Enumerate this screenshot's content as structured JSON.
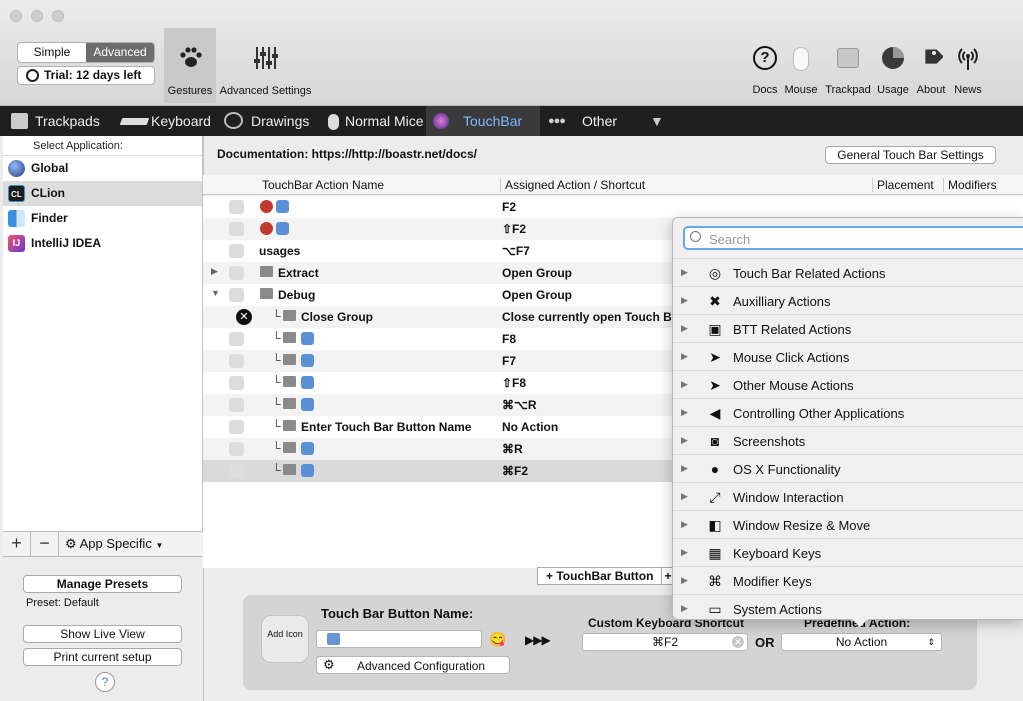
{
  "toolbar": {
    "mode_simple": "Simple",
    "mode_advanced": "Advanced",
    "trial": "Trial: 12 days left",
    "gestures": "Gestures",
    "advanced_settings": "Advanced Settings",
    "docs": "Docs",
    "mouse": "Mouse",
    "trackpad": "Trackpad",
    "usage": "Usage",
    "about": "About",
    "news": "News"
  },
  "tabs": [
    "Trackpads",
    "Keyboard",
    "Drawings",
    "Normal Mice",
    "TouchBar",
    "Other"
  ],
  "sidebar": {
    "header": "Select Application:",
    "apps": [
      {
        "name": "Global",
        "color": "#3b5c9e"
      },
      {
        "name": "CLion",
        "color": "#1c1c1c"
      },
      {
        "name": "Finder",
        "color": "#3a8fe0"
      },
      {
        "name": "IntelliJ IDEA",
        "color": "#b23a8a"
      }
    ],
    "app_specific": "App Specific",
    "manage_presets": "Manage Presets",
    "preset": "Preset: Default",
    "show_live_view": "Show Live View",
    "print_setup": "Print current setup",
    "help": "?"
  },
  "main": {
    "documentation": "Documentation: https://http://boastr.net/docs/",
    "general_settings": "General Touch Bar Settings",
    "col_name": "TouchBar Action Name",
    "col_assigned": "Assigned Action / Shortcut",
    "col_placement": "Placement",
    "col_modifiers": "Modifiers",
    "rows": [
      {
        "name": "",
        "action": "F2"
      },
      {
        "name": "",
        "action": "⇧F2"
      },
      {
        "name": "usages",
        "action": "⌥F7"
      },
      {
        "name": "Extract",
        "action": "Open Group"
      },
      {
        "name": "Debug",
        "action": "Open Group"
      },
      {
        "name": "Close Group",
        "action": "Close currently open Touch Ba"
      },
      {
        "name": "",
        "action": "F8"
      },
      {
        "name": "",
        "action": "F7"
      },
      {
        "name": "",
        "action": "⇧F8"
      },
      {
        "name": "",
        "action": "⌘⌥R"
      },
      {
        "name": "Enter Touch Bar Button Name",
        "action": "No Action"
      },
      {
        "name": "",
        "action": "⌘R"
      },
      {
        "name": "",
        "action": "⌘F2"
      }
    ],
    "add_touchbar_button": "+ TouchBar Button",
    "add_more": "+"
  },
  "editor": {
    "add_icon": "Add Icon",
    "name_label": "Touch Bar Button Name:",
    "advanced_config": "Advanced Configuration",
    "arrows": "▶▶▶",
    "shortcut_label": "Custom Keyboard Shortcut",
    "shortcut_value": "⌘F2",
    "or": "OR",
    "predefined_label": "Predefined Action:",
    "predefined_value": "No Action"
  },
  "popup": {
    "search_placeholder": "Search",
    "categories": [
      {
        "label": "Touch Bar Related Actions",
        "icon": "◎"
      },
      {
        "label": "Auxilliary Actions",
        "icon": "✖"
      },
      {
        "label": "BTT Related Actions",
        "icon": "▣"
      },
      {
        "label": "Mouse Click Actions",
        "icon": "➤"
      },
      {
        "label": "Other Mouse Actions",
        "icon": "➤"
      },
      {
        "label": "Controlling Other Applications",
        "icon": "◀"
      },
      {
        "label": "Screenshots",
        "icon": "◙"
      },
      {
        "label": "OS X Functionality",
        "icon": "●"
      },
      {
        "label": "Window Interaction",
        "icon": "⤢"
      },
      {
        "label": "Window Resize & Move",
        "icon": "◧"
      },
      {
        "label": "Keyboard Keys",
        "icon": "▦"
      },
      {
        "label": "Modifier Keys",
        "icon": "⌘"
      },
      {
        "label": "System Actions",
        "icon": "▭"
      }
    ]
  }
}
